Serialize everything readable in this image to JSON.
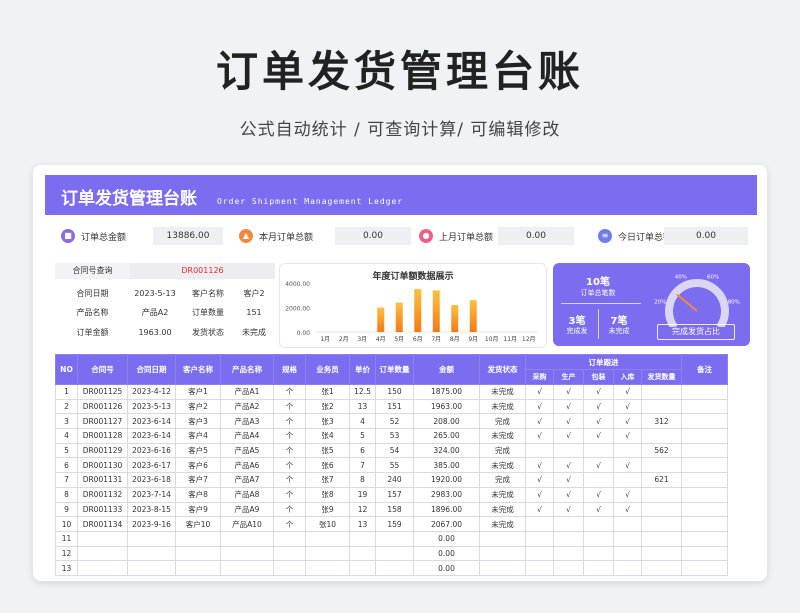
{
  "hero": {
    "title": "订单发货管理台账",
    "subtitle": "公式自动统计 / 可查询计算/ 可编辑修改"
  },
  "banner": {
    "title": "订单发货管理台账",
    "subtitle": "Order Shipment Management Ledger"
  },
  "kpis": [
    {
      "label": "订单总金额",
      "value": "13886.00",
      "icon": "purple-circle-icon",
      "color": "#8a6de0"
    },
    {
      "label": "本月订单总额",
      "value": "0.00",
      "icon": "orange-circle-icon",
      "color": "#f08a3c"
    },
    {
      "label": "上月订单总额",
      "value": "0.00",
      "icon": "pink-circle-icon",
      "color": "#ee5f8a"
    },
    {
      "label": "今日订单总额",
      "value": "0.00",
      "icon": "blue-circle-icon",
      "color": "#6f7de8"
    }
  ],
  "lookup": {
    "query_label": "合同号查询",
    "query_value": "DR001126",
    "date_label": "合同日期",
    "date_value": "2023-5-13",
    "client_label": "客户名称",
    "client_value": "客户2",
    "product_label": "产品名称",
    "product_value": "产品A2",
    "qty_label": "订单数量",
    "qty_value": "151",
    "amount_label": "订单金额",
    "amount_value": "1963.00",
    "status_label": "发货状态",
    "status_value": "未完成"
  },
  "chart_data": {
    "type": "bar",
    "title": "年度订单额数据展示",
    "categories": [
      "1月",
      "2月",
      "3月",
      "4月",
      "5月",
      "6月",
      "7月",
      "8月",
      "9月",
      "10月",
      "11月",
      "12月"
    ],
    "values": [
      0,
      0,
      0,
      2000,
      2400,
      3500,
      3400,
      2200,
      2600,
      0,
      0,
      0
    ],
    "yticks": [
      "4000.00",
      "2000.00",
      "0.00"
    ],
    "ylim": [
      0,
      4000
    ]
  },
  "stats": {
    "total_count": "10笔",
    "total_label": "订单总笔数",
    "done_count": "3笔",
    "done_label": "完成发",
    "undone_count": "7笔",
    "undone_label": "未完成",
    "gauge_ticks": [
      "0%",
      "20%",
      "40%",
      "60%",
      "80%",
      "100%"
    ],
    "gauge_value": 0.3,
    "ratio_label": "完成发货占比"
  },
  "table": {
    "headers": [
      "NO",
      "合同号",
      "合同日期",
      "客户名称",
      "产品名称",
      "规格",
      "业务员",
      "单价",
      "订单数量",
      "金额",
      "发货状态",
      "订单跟进",
      "备注"
    ],
    "sub_headers": [
      "采购",
      "生产",
      "包装",
      "入库",
      "发货数量"
    ],
    "rows": [
      [
        "1",
        "DR001125",
        "2023-4-12",
        "客户1",
        "产品A1",
        "个",
        "张1",
        "12.5",
        "150",
        "1875.00",
        "未完成",
        "√",
        "√",
        "√",
        "√",
        "",
        ""
      ],
      [
        "2",
        "DR001126",
        "2023-5-13",
        "客户2",
        "产品A2",
        "个",
        "张2",
        "13",
        "151",
        "1963.00",
        "未完成",
        "√",
        "√",
        "√",
        "√",
        "",
        ""
      ],
      [
        "3",
        "DR001127",
        "2023-6-14",
        "客户3",
        "产品A3",
        "个",
        "张3",
        "4",
        "52",
        "208.00",
        "完成",
        "√",
        "√",
        "√",
        "√",
        "312",
        ""
      ],
      [
        "4",
        "DR001128",
        "2023-6-14",
        "客户4",
        "产品A4",
        "个",
        "张4",
        "5",
        "53",
        "265.00",
        "未完成",
        "√",
        "√",
        "√",
        "√",
        "",
        ""
      ],
      [
        "5",
        "DR001129",
        "2023-6-16",
        "客户5",
        "产品A5",
        "个",
        "张5",
        "6",
        "54",
        "324.00",
        "完成",
        "",
        "",
        "",
        "",
        "562",
        ""
      ],
      [
        "6",
        "DR001130",
        "2023-6-17",
        "客户6",
        "产品A6",
        "个",
        "张6",
        "7",
        "55",
        "385.00",
        "未完成",
        "√",
        "√",
        "√",
        "√",
        "",
        ""
      ],
      [
        "7",
        "DR001131",
        "2023-6-18",
        "客户7",
        "产品A7",
        "个",
        "张7",
        "8",
        "240",
        "1920.00",
        "完成",
        "√",
        "√",
        "",
        "",
        "621",
        ""
      ],
      [
        "8",
        "DR001132",
        "2023-7-14",
        "客户8",
        "产品A8",
        "个",
        "张8",
        "19",
        "157",
        "2983.00",
        "未完成",
        "√",
        "√",
        "√",
        "√",
        "",
        ""
      ],
      [
        "9",
        "DR001133",
        "2023-8-15",
        "客户9",
        "产品A9",
        "个",
        "张9",
        "12",
        "158",
        "1896.00",
        "未完成",
        "√",
        "√",
        "√",
        "√",
        "",
        ""
      ],
      [
        "10",
        "DR001134",
        "2023-9-16",
        "客户10",
        "产品A10",
        "个",
        "张10",
        "13",
        "159",
        "2067.00",
        "未完成",
        "",
        "",
        "",
        "",
        "",
        ""
      ],
      [
        "11",
        "",
        "",
        "",
        "",
        "",
        "",
        "",
        "",
        "0.00",
        "",
        "",
        "",
        "",
        "",
        "",
        ""
      ],
      [
        "12",
        "",
        "",
        "",
        "",
        "",
        "",
        "",
        "",
        "0.00",
        "",
        "",
        "",
        "",
        "",
        "",
        ""
      ],
      [
        "13",
        "",
        "",
        "",
        "",
        "",
        "",
        "",
        "",
        "0.00",
        "",
        "",
        "",
        "",
        "",
        "",
        ""
      ]
    ]
  }
}
